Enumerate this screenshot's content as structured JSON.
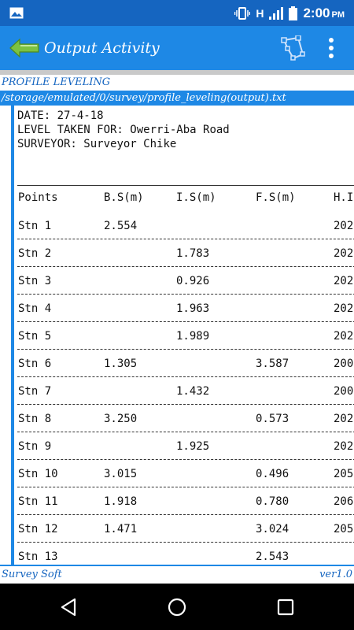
{
  "status": {
    "network": "H",
    "time": "2:00",
    "ampm": "PM"
  },
  "app_bar": {
    "title": "Output Activity"
  },
  "profile": {
    "title": "PROFILE LEVELING",
    "path": "/storage/emulated/0/survey/profile_leveling(output).txt"
  },
  "doc": {
    "date_label": "DATE:",
    "date_value": "27-4-18",
    "level_label": "LEVEL TAKEN FOR:",
    "level_value": "Owerri-Aba Road",
    "surveyor_label": "SURVEYOR:",
    "surveyor_value": "Surveyor Chike",
    "columns": [
      "Points",
      "B.S(m)",
      "I.S(m)",
      "F.S(m)",
      "H.I"
    ],
    "rows": [
      {
        "point": "Stn 1",
        "bs": "2.554",
        "is": "",
        "fs": "",
        "hi": "202"
      },
      {
        "point": "Stn 2",
        "bs": "",
        "is": "1.783",
        "fs": "",
        "hi": "202"
      },
      {
        "point": "Stn 3",
        "bs": "",
        "is": "0.926",
        "fs": "",
        "hi": "202"
      },
      {
        "point": "Stn 4",
        "bs": "",
        "is": "1.963",
        "fs": "",
        "hi": "202"
      },
      {
        "point": "Stn 5",
        "bs": "",
        "is": "1.989",
        "fs": "",
        "hi": "202"
      },
      {
        "point": "Stn 6",
        "bs": "1.305",
        "is": "",
        "fs": "3.587",
        "hi": "200"
      },
      {
        "point": "Stn 7",
        "bs": "",
        "is": "1.432",
        "fs": "",
        "hi": "200"
      },
      {
        "point": "Stn 8",
        "bs": "3.250",
        "is": "",
        "fs": "0.573",
        "hi": "202"
      },
      {
        "point": "Stn 9",
        "bs": "",
        "is": "1.925",
        "fs": "",
        "hi": "202"
      },
      {
        "point": "Stn 10",
        "bs": "3.015",
        "is": "",
        "fs": "0.496",
        "hi": "205"
      },
      {
        "point": "Stn 11",
        "bs": "1.918",
        "is": "",
        "fs": "0.780",
        "hi": "206"
      },
      {
        "point": "Stn 12",
        "bs": "1.471",
        "is": "",
        "fs": "3.024",
        "hi": "205"
      },
      {
        "point": "Stn 13",
        "bs": "",
        "is": "",
        "fs": "2.543",
        "hi": ""
      }
    ]
  },
  "footer": {
    "left": "Survey Soft",
    "right": "ver1.0"
  },
  "colors": {
    "status_bar": "#1565c0",
    "app_bar": "#1e88e5",
    "accent_text": "#1565c0",
    "arrow_green": "#7cc242"
  }
}
